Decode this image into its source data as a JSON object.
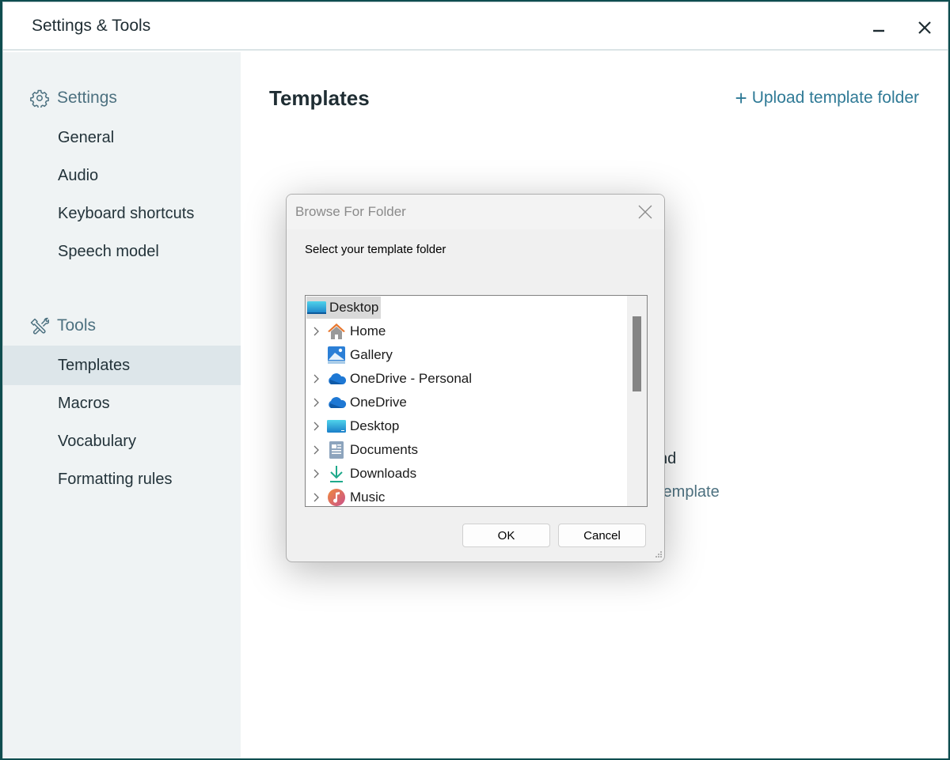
{
  "window": {
    "title": "Settings & Tools",
    "minimize_icon": "minimize-icon",
    "close_icon": "close-icon"
  },
  "sidebar": {
    "settings_section": {
      "label": "Settings",
      "icon": "gear-icon"
    },
    "settings_items": [
      {
        "label": "General"
      },
      {
        "label": "Audio"
      },
      {
        "label": "Keyboard shortcuts"
      },
      {
        "label": "Speech model"
      }
    ],
    "tools_section": {
      "label": "Tools",
      "icon": "tools-icon"
    },
    "tools_items": [
      {
        "label": "Templates",
        "active": true
      },
      {
        "label": "Macros"
      },
      {
        "label": "Vocabulary"
      },
      {
        "label": "Formatting rules"
      }
    ]
  },
  "main": {
    "title": "Templates",
    "upload_link": "Upload template folder",
    "upload_icon": "+",
    "partial_text_1": "nd",
    "partial_text_2": "template"
  },
  "dialog": {
    "title": "Browse For Folder",
    "prompt": "Select your template folder",
    "tree": {
      "root": {
        "label": "Desktop",
        "icon": "desktop-icon",
        "selected": true
      },
      "items": [
        {
          "label": "Home",
          "icon": "home-icon",
          "expandable": true
        },
        {
          "label": "Gallery",
          "icon": "gallery-icon",
          "expandable": false
        },
        {
          "label": "OneDrive - Personal",
          "icon": "onedrive-icon",
          "expandable": true
        },
        {
          "label": "OneDrive",
          "icon": "onedrive-icon",
          "expandable": true
        },
        {
          "label": "Desktop",
          "icon": "desktop-icon",
          "expandable": true
        },
        {
          "label": "Documents",
          "icon": "documents-icon",
          "expandable": true
        },
        {
          "label": "Downloads",
          "icon": "downloads-icon",
          "expandable": true
        },
        {
          "label": "Music",
          "icon": "music-icon",
          "expandable": true
        }
      ]
    },
    "ok_label": "OK",
    "cancel_label": "Cancel"
  },
  "colors": {
    "accent": "#2f7a96",
    "sidebar_bg": "#eff3f4",
    "sidebar_active": "#dde6ea",
    "section_text": "#4d7180"
  }
}
